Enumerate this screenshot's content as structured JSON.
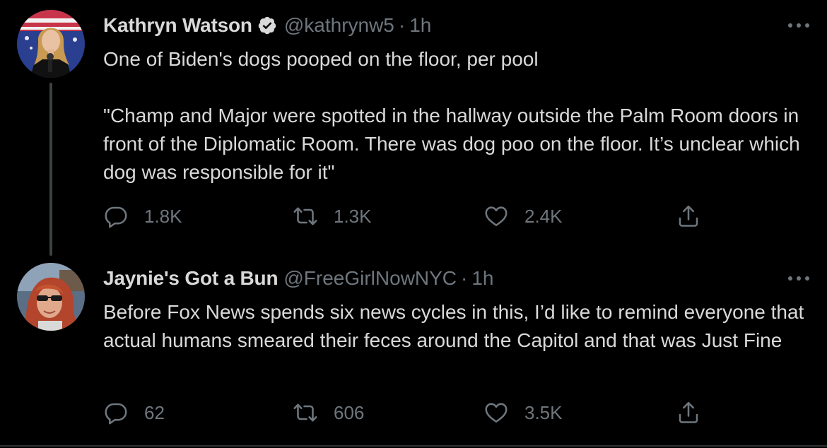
{
  "tweets": [
    {
      "display_name": "Kathryn Watson",
      "verified": true,
      "handle": "@kathrynw5",
      "separator": "·",
      "time": "1h",
      "paragraphs": [
        "One of Biden's dogs pooped on the floor, per pool",
        "\"Champ and Major were spotted in the hallway outside the Palm Room doors in front of the Diplomatic Room. There was dog poo on the floor. It’s unclear which dog was responsible for it\""
      ],
      "replies": "1.8K",
      "retweets": "1.3K",
      "likes": "2.4K"
    },
    {
      "display_name": "Jaynie's Got a Bun",
      "verified": false,
      "handle": "@FreeGirlNowNYC",
      "separator": "·",
      "time": "1h",
      "paragraphs": [
        "Before Fox News spends six news cycles in this, I’d like to remind everyone that actual humans smeared their feces around the Capitol and that was Just Fine"
      ],
      "replies": "62",
      "retweets": "606",
      "likes": "3.5K"
    }
  ],
  "icons": {
    "reply": "reply-icon",
    "retweet": "retweet-icon",
    "like": "like-icon",
    "share": "share-icon",
    "more": "more-icon",
    "verified": "verified-badge-icon"
  },
  "colors": {
    "background": "#000000",
    "primary_text": "#d9d9d9",
    "secondary_text": "#6e767d",
    "thread_line": "#3d4144"
  }
}
